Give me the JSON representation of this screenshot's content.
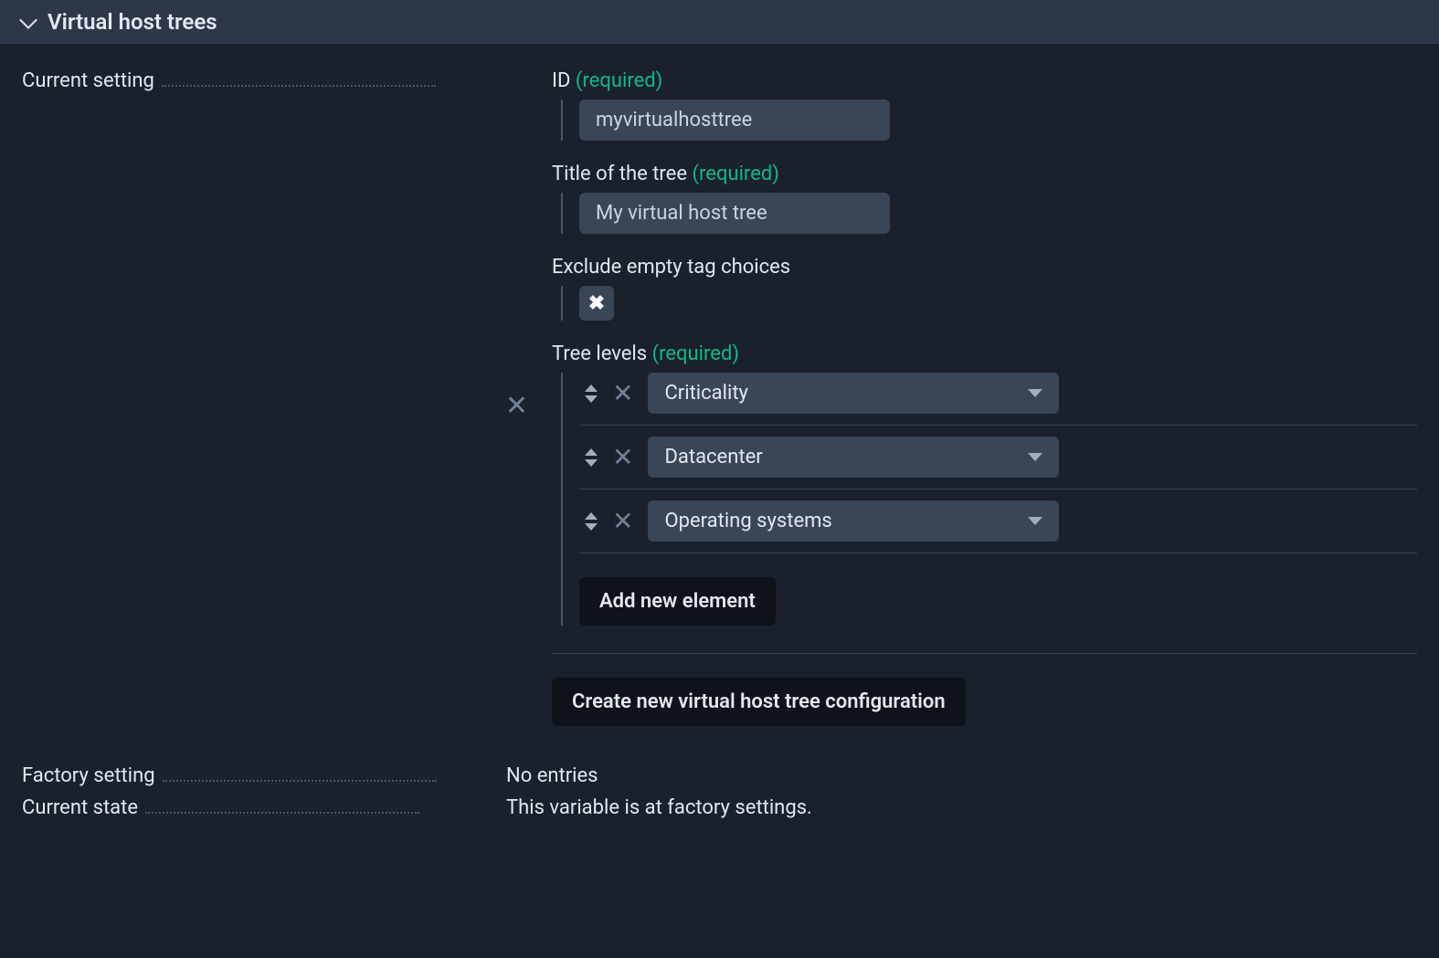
{
  "header": {
    "title": "Virtual host trees"
  },
  "currentSetting": {
    "label": "Current setting",
    "id": {
      "label": "ID",
      "required": "(required)",
      "value": "myvirtualhosttree"
    },
    "title": {
      "label": "Title of the tree",
      "required": "(required)",
      "value": "My virtual host tree"
    },
    "exclude": {
      "label": "Exclude empty tag choices"
    },
    "treeLevels": {
      "label": "Tree levels",
      "required": "(required)",
      "items": [
        {
          "value": "Criticality"
        },
        {
          "value": "Datacenter"
        },
        {
          "value": "Operating systems"
        }
      ],
      "addButton": "Add new element"
    },
    "createButton": "Create new virtual host tree configuration"
  },
  "factorySetting": {
    "label": "Factory setting",
    "value": "No entries"
  },
  "currentState": {
    "label": "Current state",
    "value": "This variable is at factory settings."
  }
}
